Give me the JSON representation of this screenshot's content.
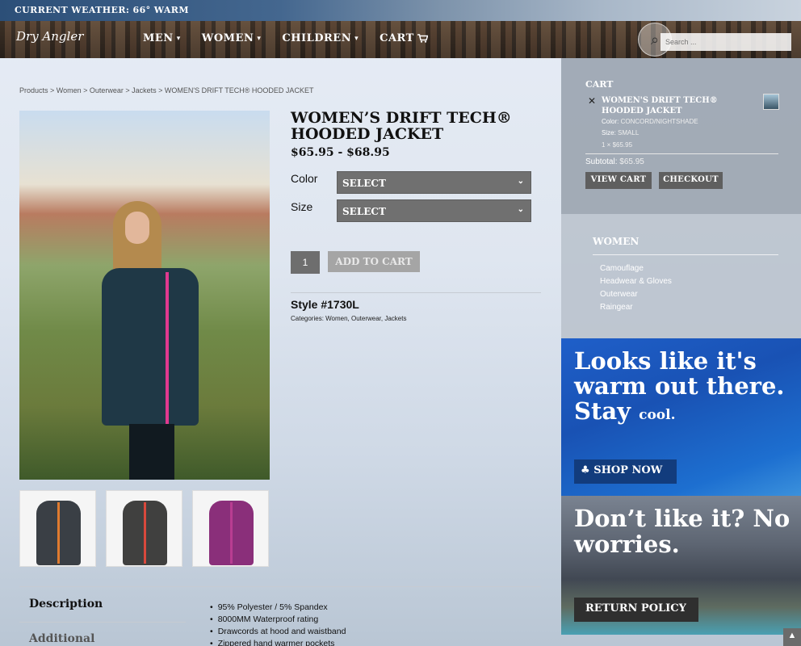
{
  "weather": {
    "text": "CURRENT WEATHER: 66° WARM"
  },
  "nav": {
    "logo": "Dry Angler",
    "items": [
      {
        "label": "MEN",
        "chevron": "⌄"
      },
      {
        "label": "WOMEN",
        "chevron": "⌄"
      },
      {
        "label": "CHILDREN",
        "chevron": "⌄"
      },
      {
        "label": "CART",
        "icon": "cart-icon"
      }
    ],
    "search_placeholder": "Search ..."
  },
  "breadcrumb": "Products > Women > Outerwear > Jackets > WOMEN'S DRIFT TECH® HOODED JACKET",
  "product": {
    "title": "WOMEN’S DRIFT TECH® HOODED JACKET",
    "price": "$65.95 - $68.95",
    "color_label": "Color",
    "size_label": "Size",
    "select_label": "SELECT",
    "quantity": "1",
    "add_to_cart": "ADD TO CART",
    "style": "Style #1730L",
    "categories": "Categories: Women, Outerwear, Jackets",
    "thumbnails": [
      {
        "jacket_color": "#3a3f45",
        "zip_color": "#e07b2f"
      },
      {
        "jacket_color": "#40403f",
        "zip_color": "#d9493c"
      },
      {
        "jacket_color": "#8a2f7a",
        "zip_color": "#b83d91"
      }
    ]
  },
  "tabs": {
    "description": "Description",
    "additional": "Additional"
  },
  "description_items": [
    "95% Polyester / 5% Spandex",
    "8000MM Waterproof rating",
    "Drawcords at hood and waistband",
    "Zippered hand warmer pockets"
  ],
  "cart_widget": {
    "title": "CART",
    "item_name": "WOMEN'S DRIFT TECH® HOODED JACKET",
    "color_label": "Color:",
    "color_value": "CONCORD/NIGHTSHADE",
    "size_label": "Size:",
    "size_value": "SMALL",
    "qty_price": "1 × $65.95",
    "subtotal_label": "Subtotal:",
    "subtotal_value": "$65.95",
    "view_cart": "VIEW CART",
    "checkout": "CHECKOUT"
  },
  "women_widget": {
    "title": "WOMEN",
    "items": [
      "Camouflage",
      "Headwear & Gloves",
      "Outerwear",
      "Raingear"
    ]
  },
  "promo_warm": {
    "headline": "Looks like it's warm out there. Stay",
    "headline_small": "cool.",
    "button": "SHOP NOW"
  },
  "promo_worries": {
    "headline": "Don’t like it? No worries.",
    "button": "RETURN POLICY"
  }
}
